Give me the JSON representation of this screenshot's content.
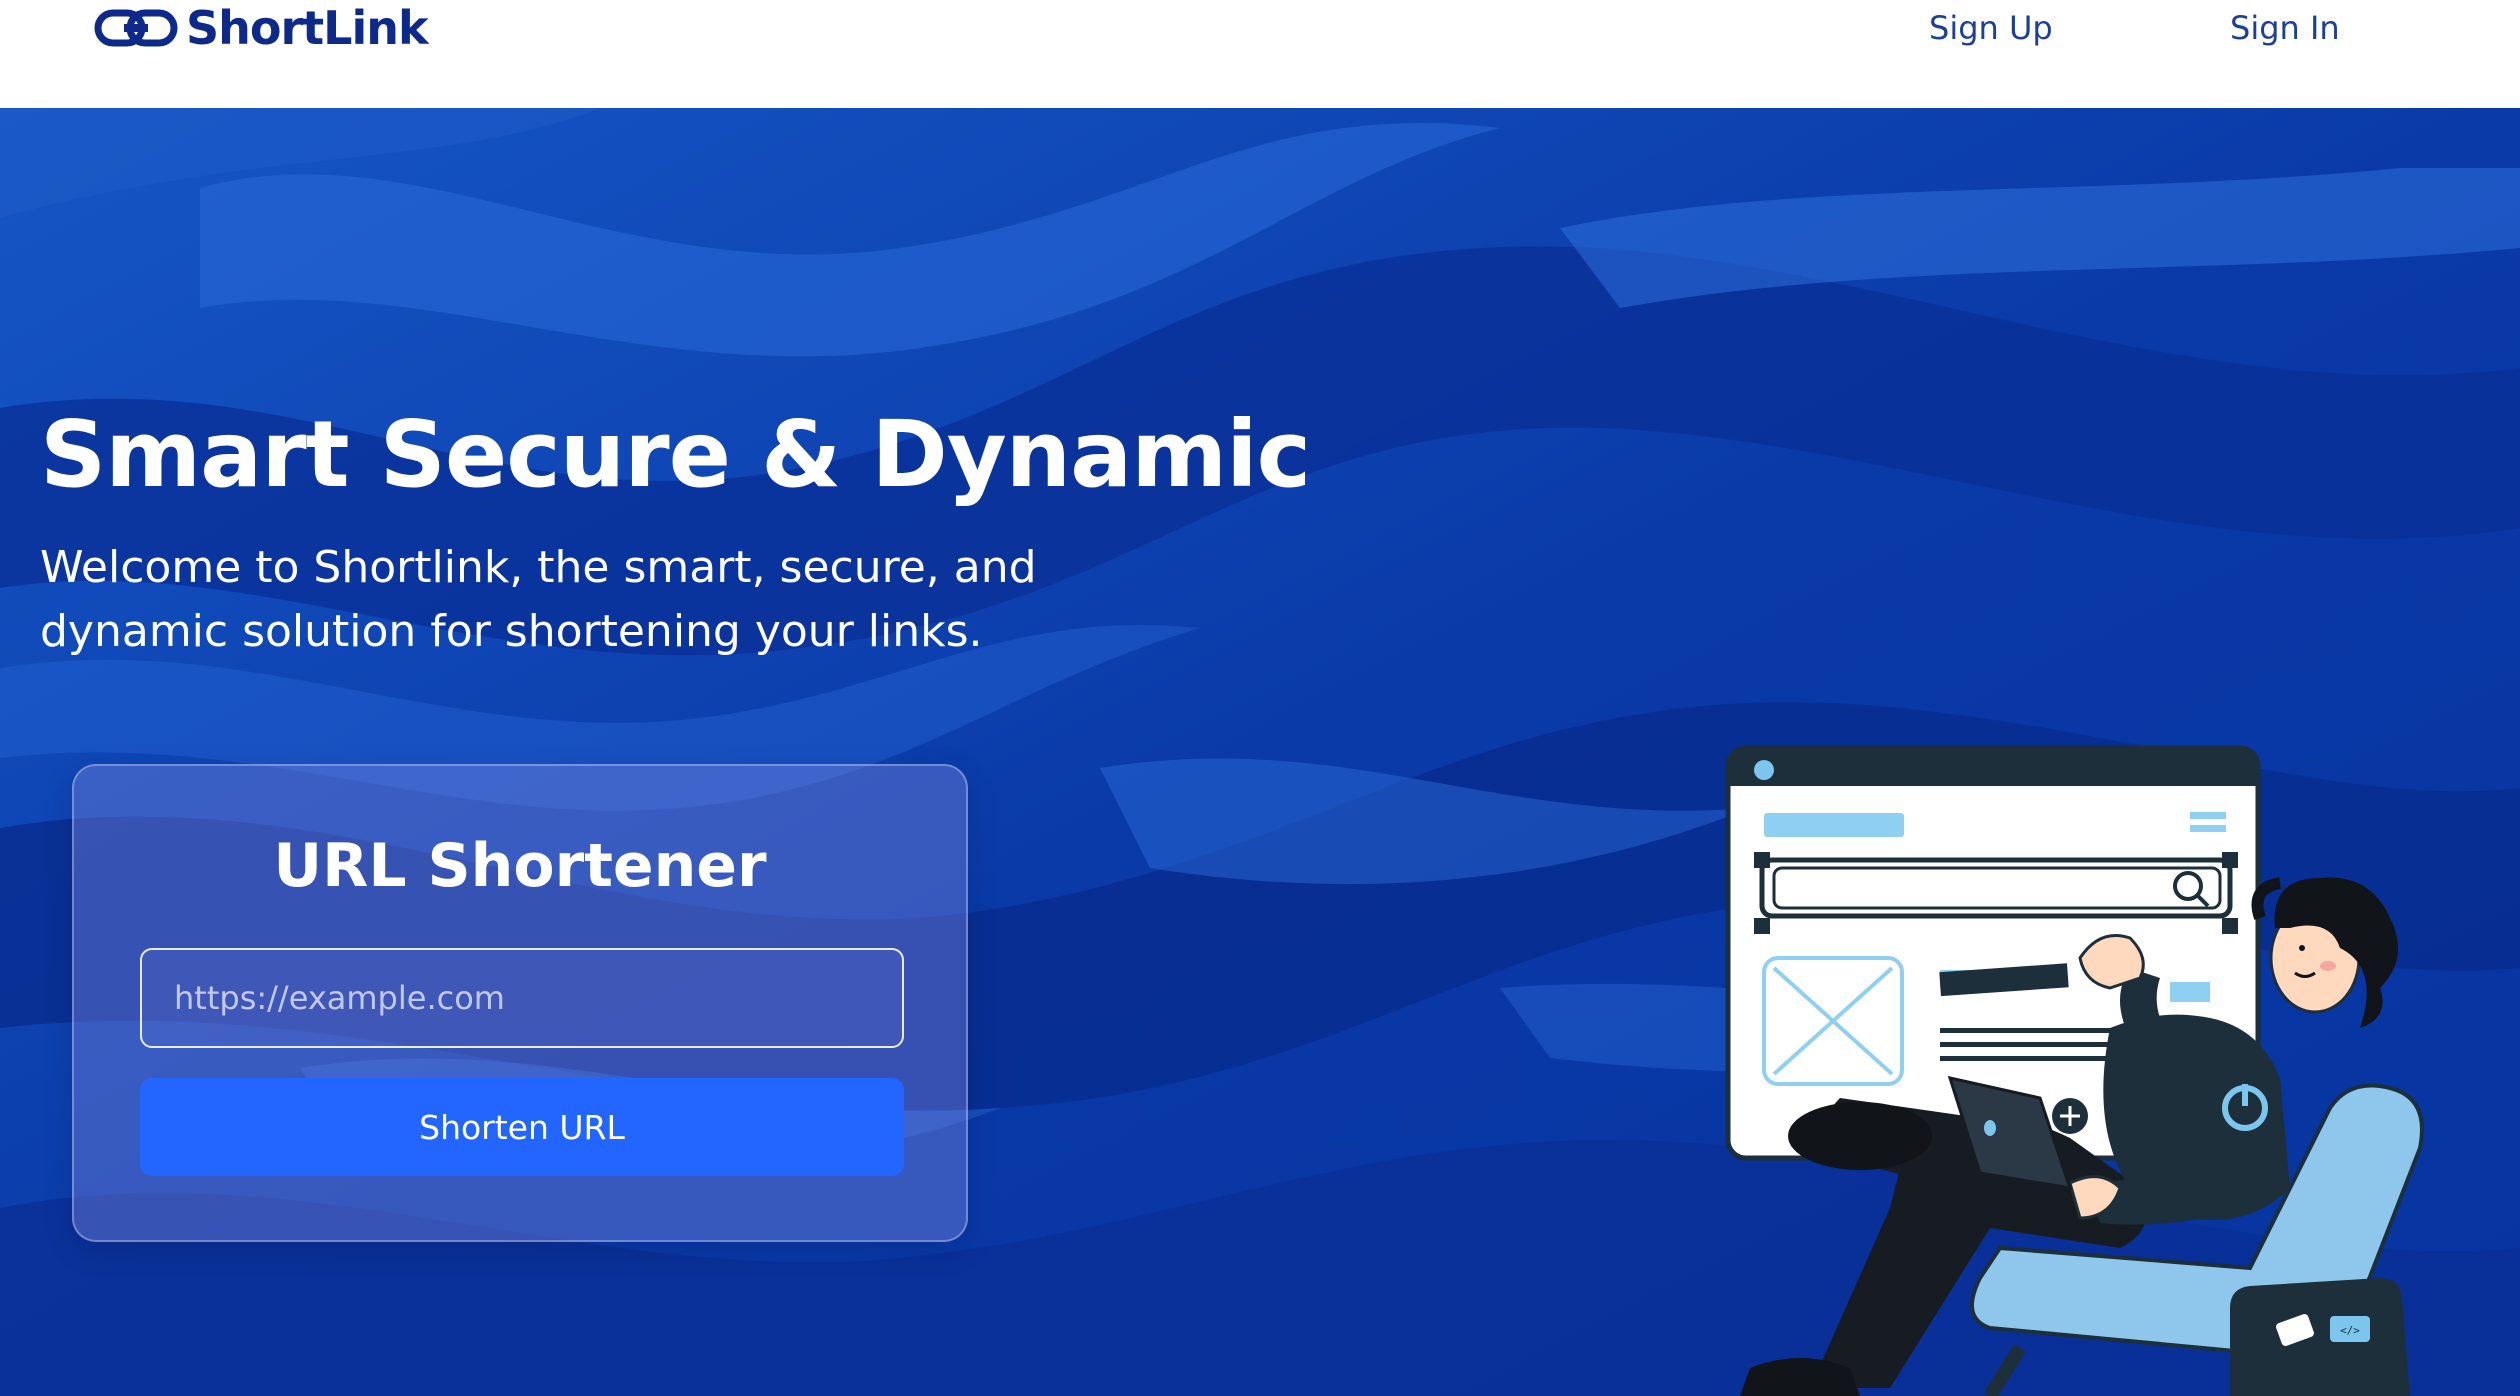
{
  "header": {
    "brand": "ShortLink",
    "nav": {
      "sign_up": "Sign Up",
      "sign_in": "Sign In"
    }
  },
  "hero": {
    "title": "Smart Secure & Dynamic",
    "subtitle": "Welcome to Shortlink, the smart, secure, and dynamic solution for shortening your links."
  },
  "card": {
    "title": "URL Shortener",
    "input_value": "",
    "input_placeholder": "https://example.com",
    "button_label": "Shorten URL"
  },
  "icons": {
    "logo": "link-chain-icon",
    "illustration": "man-with-laptop-illustration"
  },
  "colors": {
    "brand": "#0d2a8a",
    "nav_link": "#1c3f9a",
    "hero_background": "#0a3aa8",
    "button": "#2266ff",
    "text_light": "#ffffff"
  }
}
